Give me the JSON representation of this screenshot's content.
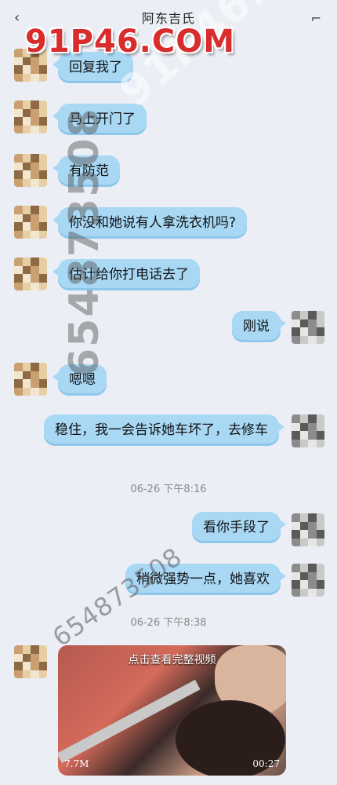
{
  "header": {
    "title": "阿东吉氏"
  },
  "messages": [
    {
      "side": "left",
      "text": "回复我了"
    },
    {
      "side": "left",
      "text": "马上开门了"
    },
    {
      "side": "left",
      "text": "有防范"
    },
    {
      "side": "left",
      "text": "你没和她说有人拿洗衣机吗?"
    },
    {
      "side": "left",
      "text": "估计给你打电话去了"
    },
    {
      "side": "right",
      "text": "刚说"
    },
    {
      "side": "left",
      "text": "嗯嗯"
    },
    {
      "side": "right",
      "text": "稳住，我一会告诉她车坏了，去修车"
    },
    {
      "side": "right",
      "text": "看你手段了"
    },
    {
      "side": "right",
      "text": "稍微强势一点，她喜欢"
    }
  ],
  "timestamps": [
    "06-26 下午8:16",
    "06-26 下午8:38"
  ],
  "video": {
    "caption": "点击查看完整视频",
    "size": "7.7M",
    "duration": "00:27"
  },
  "watermarks": {
    "logo": "91P46.COM",
    "diagonal": "91P46.COM",
    "vertical": "654873508",
    "number": "654873508"
  },
  "colors": {
    "background": "#eceef6",
    "bubble": "#a9d8f5",
    "logo": "#d92c2c"
  },
  "icons": {
    "back": "chevron-left-icon",
    "more": "more-icon"
  }
}
